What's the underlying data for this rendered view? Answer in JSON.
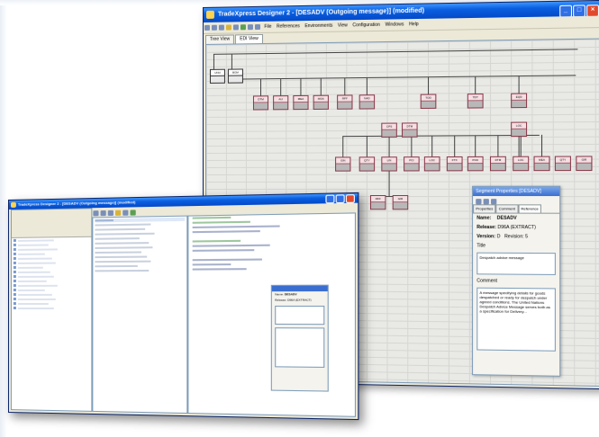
{
  "big_window": {
    "title": "TradeXpress Designer 2 - [DESADV (Outgoing message)] (modified)",
    "menu": [
      "File",
      "References",
      "Environments",
      "View",
      "Configuration",
      "Windows",
      "Help"
    ],
    "tabs": [
      "Tree View",
      "EDI View"
    ],
    "nodes": [
      {
        "label": "UNH"
      },
      {
        "label": "BGM"
      },
      {
        "label": "DTM"
      },
      {
        "label": "ALI"
      },
      {
        "label": "MEA"
      },
      {
        "label": "MOA"
      },
      {
        "label": "RFF"
      },
      {
        "label": "NAD"
      },
      {
        "label": "TOD"
      },
      {
        "label": "TDT"
      },
      {
        "label": "EQD"
      },
      {
        "label": "CPS"
      },
      {
        "label": "DTM"
      },
      {
        "label": "LOC"
      },
      {
        "label": "GIN"
      },
      {
        "label": "QTY"
      },
      {
        "label": "LIN"
      },
      {
        "label": "PCI"
      },
      {
        "label": "LOC"
      },
      {
        "label": "FTX"
      },
      {
        "label": "PCD"
      },
      {
        "label": "DTM"
      },
      {
        "label": "LOC"
      },
      {
        "label": "MEA"
      },
      {
        "label": "QTY"
      },
      {
        "label": "GIR"
      },
      {
        "label": "RFF"
      },
      {
        "label": "GIR"
      }
    ]
  },
  "prop_panel": {
    "title": "Segment Properties [DESADV]",
    "tabs": [
      "Properties",
      "Comment",
      "Reference"
    ],
    "name_label": "Name:",
    "name_value": "DESADV",
    "release_label": "Release:",
    "release_value": "D96A (EXTRACT)",
    "version_label": "Version:",
    "version_value": "D",
    "revision_label": "Revision:",
    "revision_value": "5",
    "title_label": "Title",
    "title_value": "Despatch advice message",
    "comment_label": "Comment",
    "comment_value": "A message specifying details for goods despatched or ready for despatch under agreed conditions. The United Nations Despatch Advice Message serves both as a specification for Delivery..."
  },
  "small_window": {
    "title": "TradeXpress Designer 2 - [DESADV (Outgoing message)] (modified)"
  }
}
